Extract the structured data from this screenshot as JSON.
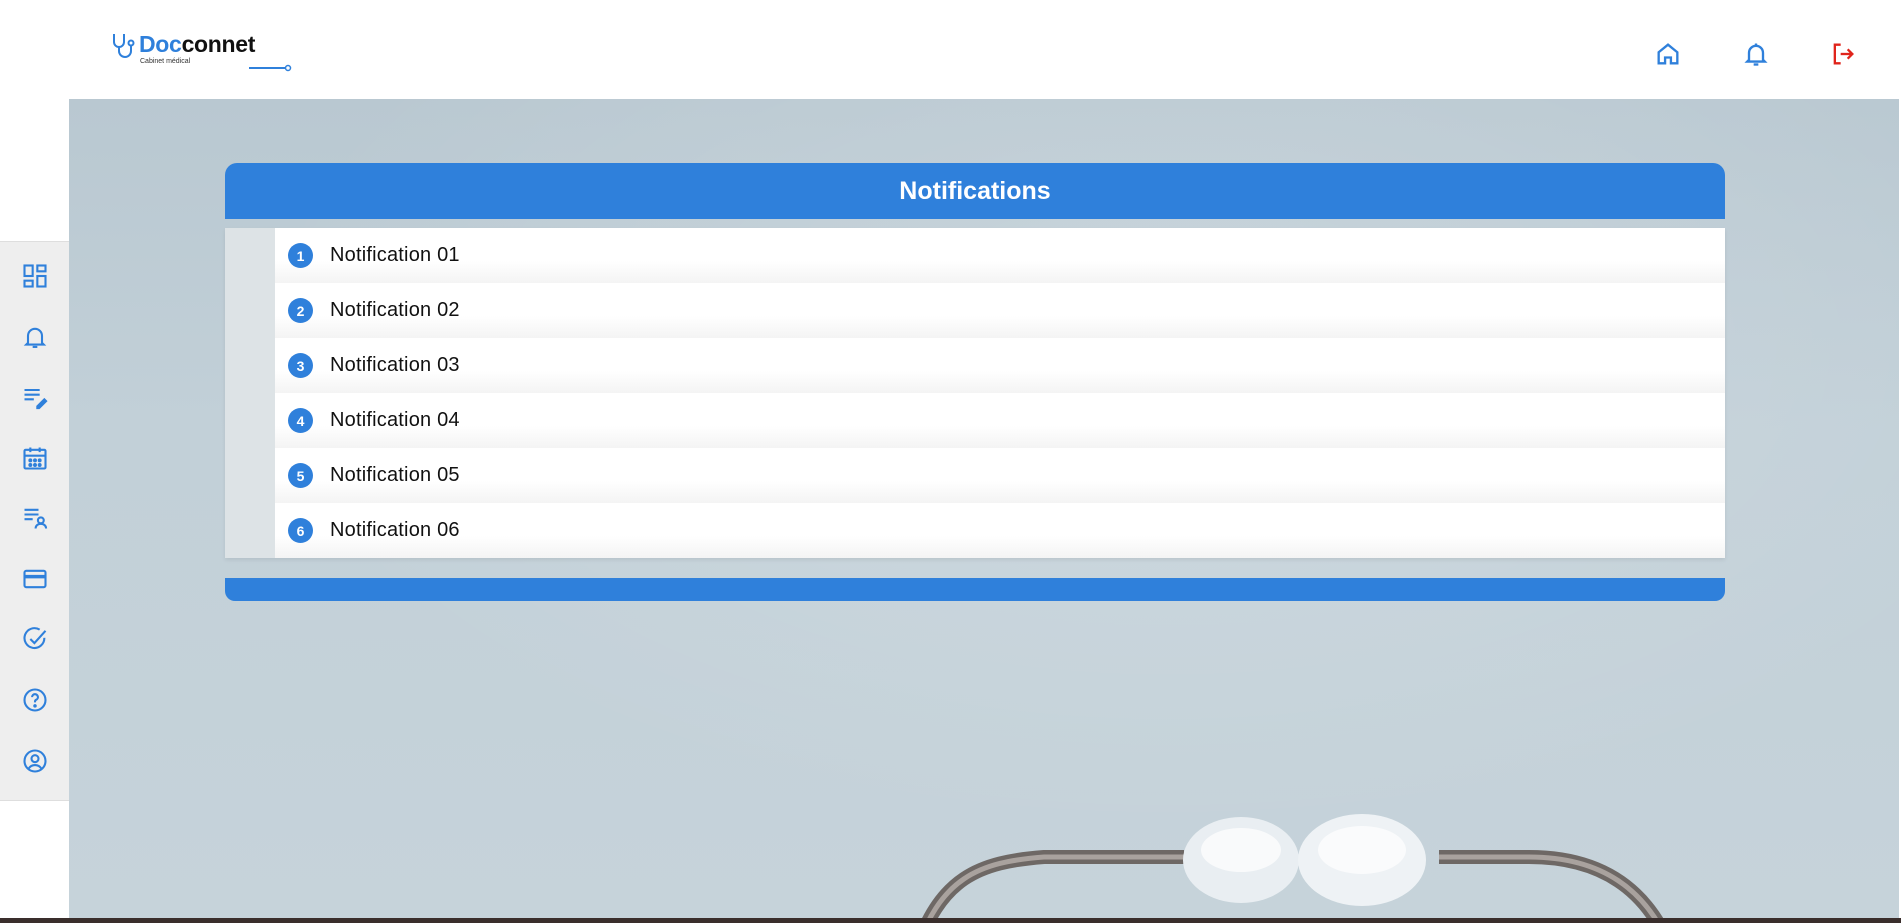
{
  "brand": {
    "name_part1": "Doc",
    "name_part2": "connet",
    "subtitle": "Cabinet médical",
    "primary_color": "#2f80db"
  },
  "header": {
    "actions": [
      {
        "name": "home-icon",
        "color": "#2f80db"
      },
      {
        "name": "bell-icon",
        "color": "#2f80db"
      },
      {
        "name": "logout-icon",
        "color": "#e0241b"
      }
    ]
  },
  "sidebar": {
    "items": [
      {
        "icon": "dashboard-icon"
      },
      {
        "icon": "bell-icon"
      },
      {
        "icon": "edit-list-icon"
      },
      {
        "icon": "calendar-icon"
      },
      {
        "icon": "patient-list-icon"
      },
      {
        "icon": "credit-card-icon"
      },
      {
        "icon": "check-circle-icon"
      },
      {
        "icon": "help-icon"
      },
      {
        "icon": "account-icon"
      }
    ]
  },
  "notifications": {
    "title": "Notifications",
    "items": [
      {
        "number": "1",
        "label": "Notification 01"
      },
      {
        "number": "2",
        "label": "Notification 02"
      },
      {
        "number": "3",
        "label": "Notification 03"
      },
      {
        "number": "4",
        "label": "Notification 04"
      },
      {
        "number": "5",
        "label": "Notification 05"
      },
      {
        "number": "6",
        "label": "Notification 06"
      }
    ]
  }
}
